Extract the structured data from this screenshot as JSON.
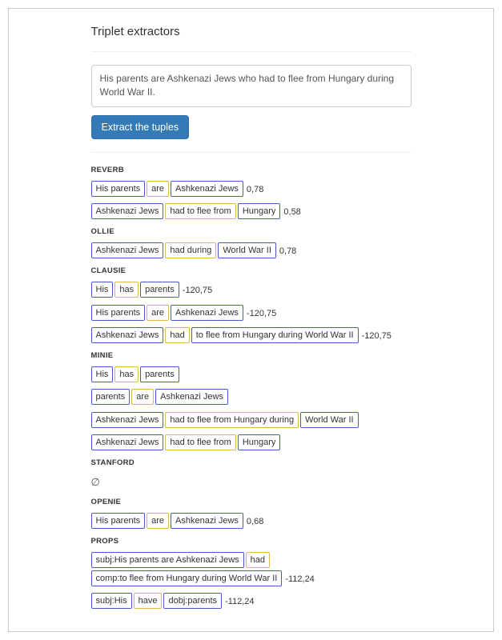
{
  "title": "Triplet extractors",
  "sentence": "His parents are Ashkenazi Jews who had to flee from Hungary during World War II.",
  "button_label": "Extract the tuples",
  "empty_symbol": "∅",
  "sections": [
    {
      "name": "REVERB",
      "rows": [
        {
          "subj": "His parents",
          "rel": "are",
          "obj": "Ashkenazi Jews",
          "score": "0,78"
        },
        {
          "subj": "Ashkenazi Jews",
          "rel": "had to flee from",
          "obj": "Hungary",
          "score": "0,58"
        }
      ]
    },
    {
      "name": "OLLIE",
      "rows": [
        {
          "subj": "Ashkenazi Jews",
          "rel": "had during",
          "obj": "World War II",
          "score": "0,78"
        }
      ]
    },
    {
      "name": "CLAUSIE",
      "rows": [
        {
          "subj": "His",
          "rel": "has",
          "obj": "parents",
          "score": "-120,75"
        },
        {
          "subj": "His parents",
          "rel": "are",
          "obj": "Ashkenazi Jews",
          "score": "-120,75"
        },
        {
          "subj": "Ashkenazi Jews",
          "rel": "had",
          "obj": "to flee from Hungary during World War II",
          "score": "-120,75"
        }
      ]
    },
    {
      "name": "MINIE",
      "rows": [
        {
          "subj": "His",
          "rel": "has",
          "obj": "parents"
        },
        {
          "subj": "parents",
          "rel": "are",
          "obj": "Ashkenazi Jews"
        },
        {
          "subj": "Ashkenazi Jews",
          "rel": "had to flee from Hungary during",
          "obj": "World War II"
        },
        {
          "subj": "Ashkenazi Jews",
          "rel": "had to flee from",
          "obj": "Hungary"
        }
      ]
    },
    {
      "name": "STANFORD",
      "rows": []
    },
    {
      "name": "OPENIE",
      "rows": [
        {
          "subj": "His parents",
          "rel": "are",
          "obj": "Ashkenazi Jews",
          "score": "0,68"
        }
      ]
    },
    {
      "name": "PROPS",
      "rows": [
        {
          "subj": "subj:His parents are Ashkenazi Jews",
          "rel": "had",
          "obj": "comp:to flee from Hungary during World War II",
          "score": "-112,24"
        },
        {
          "subj": "subj:His",
          "rel": "have",
          "obj": "dobj:parents",
          "score": "-112,24"
        }
      ]
    }
  ]
}
